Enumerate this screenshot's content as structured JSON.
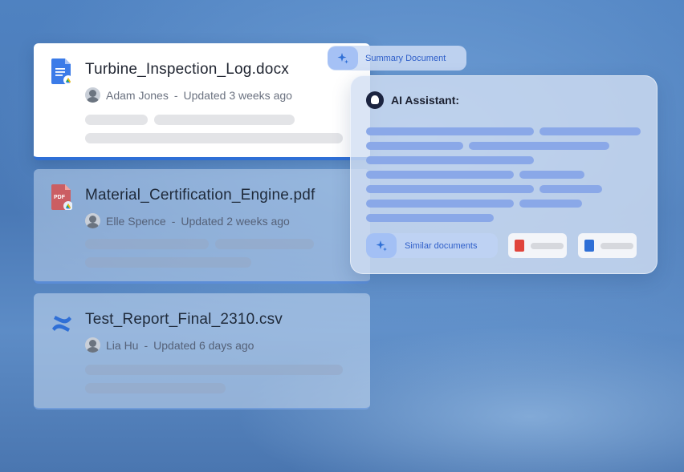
{
  "files": [
    {
      "name": "Turbine_Inspection_Log.docx",
      "icon": "google-docs-icon",
      "author": "Adam Jones",
      "updated": "Updated 3 weeks ago"
    },
    {
      "name": "Material_Certification_Engine.pdf",
      "icon": "pdf-file-icon",
      "author": "Elle Spence",
      "updated": "Updated 2 weeks ago"
    },
    {
      "name": "Test_Report_Final_2310.csv",
      "icon": "confluence-icon",
      "author": "Lia Hu",
      "updated": "Updated 6 days ago"
    }
  ],
  "separator": "-",
  "summary_button": {
    "label": "Summary Document",
    "icon": "sparkle-icon"
  },
  "ai_panel": {
    "title": "AI Assistant:",
    "similar_label": "Similar documents",
    "pdf_badge": "PDF"
  },
  "colors": {
    "accent": "#2f6fd6",
    "ai_line": "#8aa8e8",
    "pill_text": "#2f5fc9",
    "pdf_red": "#e0443c",
    "docs_blue": "#2f6fd6"
  }
}
